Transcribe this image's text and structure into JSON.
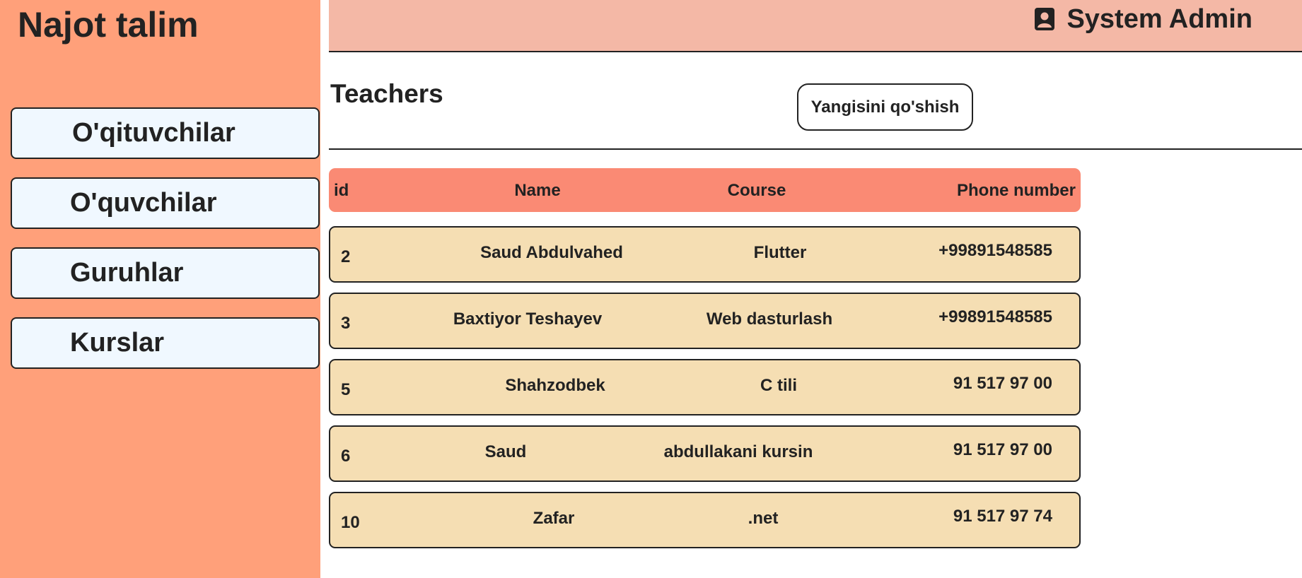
{
  "sidebar": {
    "brand": "Najot talim",
    "items": [
      {
        "label": "O'qituvchilar"
      },
      {
        "label": "O'quvchilar"
      },
      {
        "label": "Guruhlar"
      },
      {
        "label": "Kurslar"
      }
    ]
  },
  "header": {
    "user_label": "System Admin",
    "user_icon": "user-badge-icon"
  },
  "main": {
    "title": "Teachers",
    "add_button_label": "Yangisini qo'shish",
    "table": {
      "columns": [
        "id",
        "Name",
        "Course",
        "Phone number"
      ],
      "rows": [
        {
          "id": "2",
          "name": "Saud Abdulvahed",
          "course": "Flutter",
          "phone": "+99891548585"
        },
        {
          "id": "3",
          "name": "Baxtiyor Teshayev",
          "course": "Web dasturlash",
          "phone": "+99891548585"
        },
        {
          "id": "5",
          "name": "Shahzodbek",
          "course": "C tili",
          "phone": "91 517 97 00"
        },
        {
          "id": "6",
          "name": "Saud",
          "course": "abdullakani kursin",
          "phone": "91 517 97 00"
        },
        {
          "id": "10",
          "name": "Zafar",
          "course": ".net",
          "phone": "91 517 97 74"
        }
      ]
    }
  },
  "colors": {
    "sidebar_bg": "#ffa07a",
    "topbar_bg": "#f4b8a6",
    "nav_item_bg": "#f0f8ff",
    "table_header_bg": "#fa8a74",
    "row_bg": "#f5deb3"
  }
}
